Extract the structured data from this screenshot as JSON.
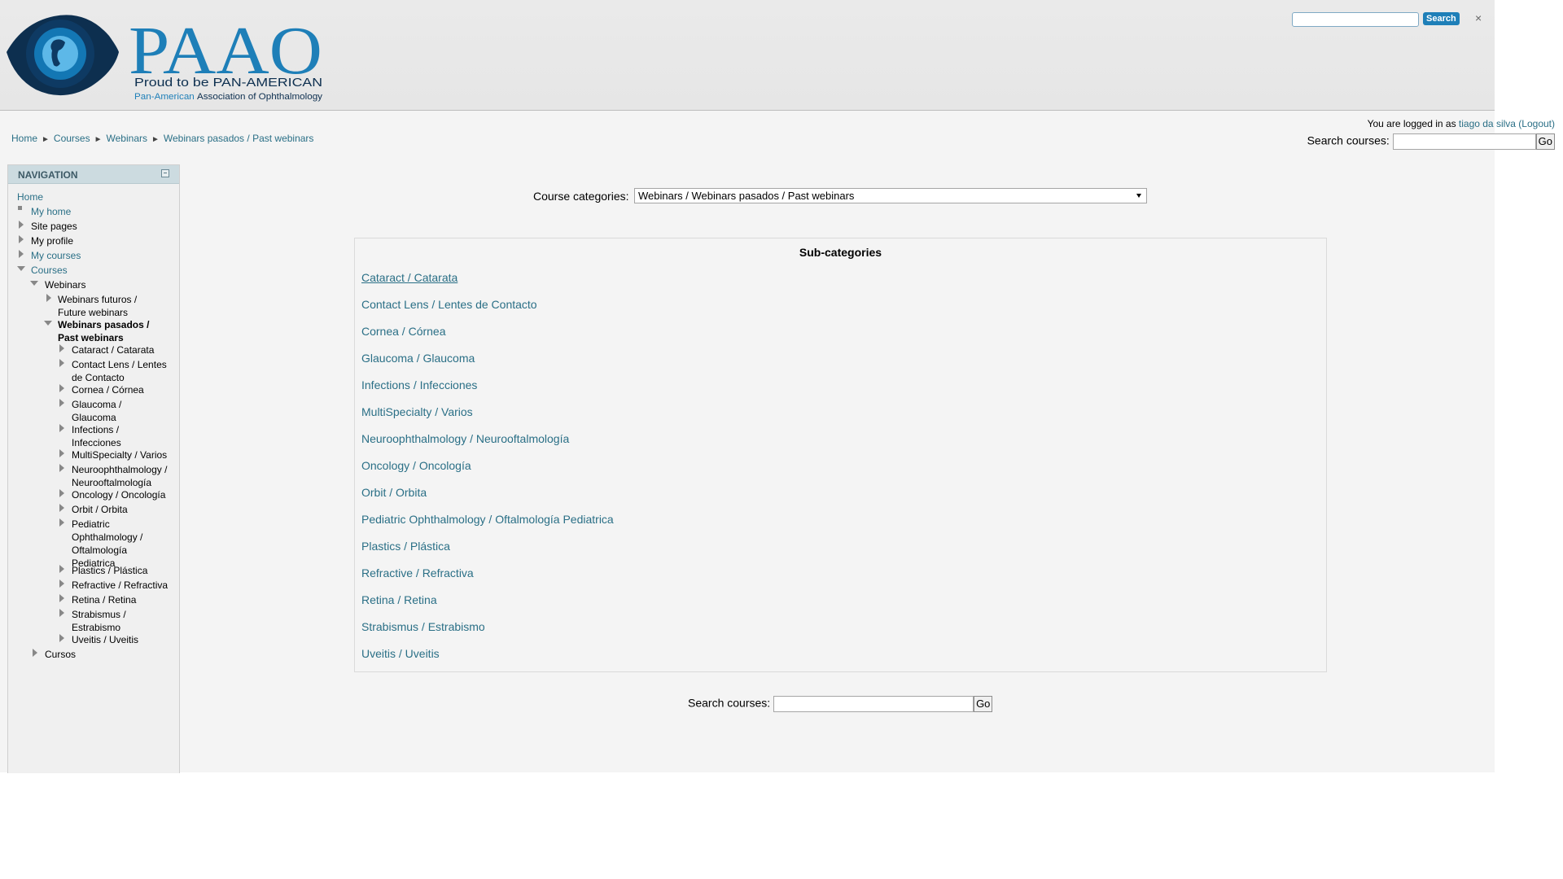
{
  "header": {
    "logo": {
      "wordmark": "PAAO",
      "tagline": "Proud to be PAN-AMERICAN",
      "org_prefix": "Pan-American",
      "org_rest": "Association of Ophthalmology"
    },
    "search_button": "Search",
    "close": "×"
  },
  "user": {
    "prefix": "You are logged in as ",
    "name": "tiago da silva",
    "logout": "(Logout)"
  },
  "search": {
    "label": "Search courses:",
    "go": "Go"
  },
  "breadcrumb": {
    "sep": "►",
    "items": [
      "Home",
      "Courses",
      "Webinars",
      "Webinars pasados / Past webinars"
    ]
  },
  "navigation": {
    "title": "NAVIGATION",
    "items": [
      {
        "label": "Home"
      },
      {
        "label": "My home"
      },
      {
        "label": "Site pages"
      },
      {
        "label": "My profile"
      },
      {
        "label": "My courses"
      },
      {
        "label": "Courses"
      },
      {
        "label": "Webinars"
      },
      {
        "label": "Webinars futuros / Future webinars"
      },
      {
        "label": "Webinars pasados / Past webinars"
      },
      {
        "label": "Cataract / Catarata"
      },
      {
        "label": "Contact Lens / Lentes de Contacto"
      },
      {
        "label": "Cornea / Córnea"
      },
      {
        "label": "Glaucoma / Glaucoma"
      },
      {
        "label": "Infections / Infecciones"
      },
      {
        "label": "MultiSpecialty / Varios"
      },
      {
        "label": "Neuroophthalmology / Neurooftalmología"
      },
      {
        "label": "Oncology / Oncología"
      },
      {
        "label": "Orbit / Orbita"
      },
      {
        "label": "Pediatric Ophthalmology / Oftalmología Pediatrica"
      },
      {
        "label": "Plastics / Plástica"
      },
      {
        "label": "Refractive / Refractiva"
      },
      {
        "label": "Retina / Retina"
      },
      {
        "label": "Strabismus / Estrabismo"
      },
      {
        "label": "Uveitis / Uveitis"
      },
      {
        "label": "Cursos"
      }
    ]
  },
  "course_categories": {
    "label": "Course categories:",
    "selected": "Webinars / Webinars pasados / Past webinars"
  },
  "subcategories": {
    "title": "Sub-categories",
    "items": [
      "Cataract / Catarata",
      "Contact Lens / Lentes de Contacto",
      "Cornea / Córnea",
      "Glaucoma / Glaucoma",
      "Infections / Infecciones",
      "MultiSpecialty / Varios",
      "Neuroophthalmology / Neurooftalmología",
      "Oncology / Oncología",
      "Orbit / Orbita",
      "Pediatric Ophthalmology / Oftalmología Pediatrica",
      "Plastics / Plástica",
      "Refractive / Refractiva",
      "Retina / Retina",
      "Strabismus / Estrabismo",
      "Uveitis / Uveitis"
    ]
  },
  "colors": {
    "link": "#2a6f86",
    "brand_blue": "#1e7fb8",
    "brand_dark": "#0d2f4f",
    "nav_header": "#ccdbe0"
  }
}
